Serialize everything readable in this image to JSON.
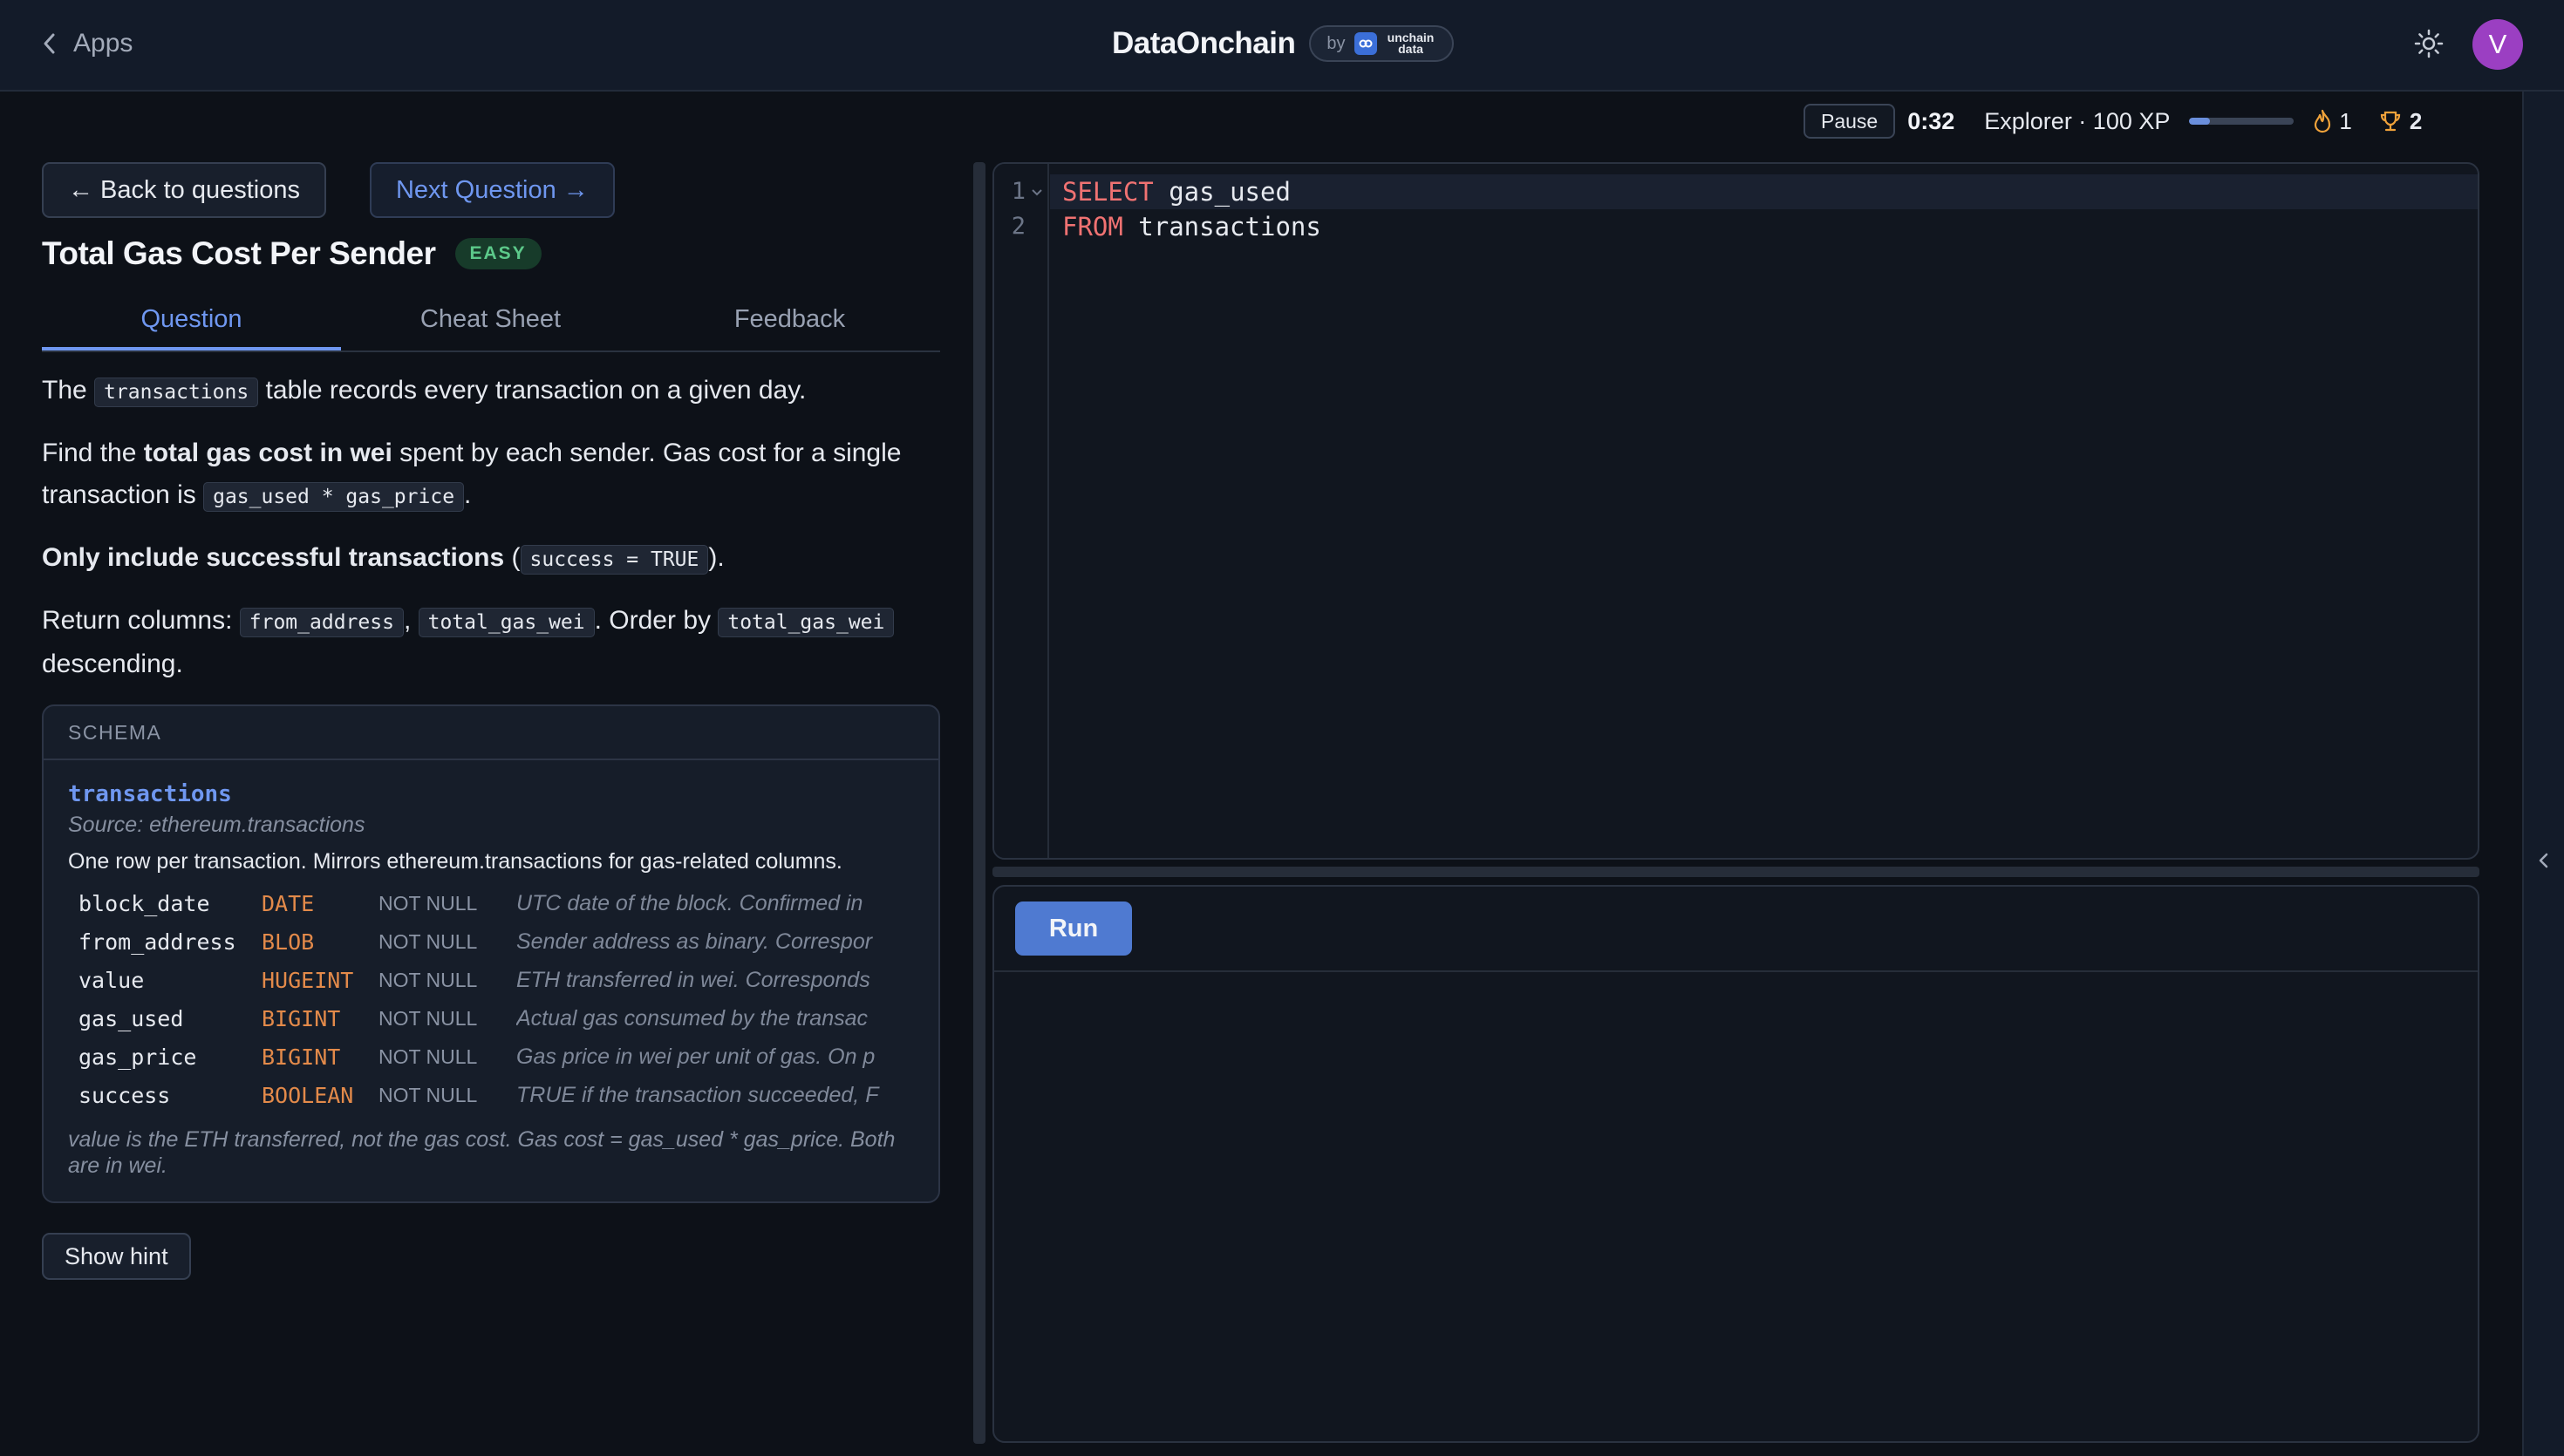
{
  "topbar": {
    "back_label": "Apps",
    "brand": "DataOnchain",
    "brand_by": "by",
    "brand_partner": "unchain data",
    "avatar_initial": "V"
  },
  "status": {
    "pause_label": "Pause",
    "timer": "0:32",
    "level_label": "Explorer · 100 XP",
    "xp_progress": 0.2,
    "streak": "1",
    "trophies": "2"
  },
  "nav": {
    "back_label": "← Back to questions",
    "next_label": "Next Question →"
  },
  "question": {
    "title": "Total Gas Cost Per Sender",
    "difficulty": "EASY",
    "tabs": [
      "Question",
      "Cheat Sheet",
      "Feedback"
    ],
    "active_tab": 0,
    "p1_pre": "The ",
    "p1_code": "transactions",
    "p1_post": " table records every transaction on a given day.",
    "p2_pre": "Find the ",
    "p2_bold": "total gas cost in wei",
    "p2_mid": " spent by each sender. Gas cost for a single transaction is ",
    "p2_code": "gas_used * gas_price",
    "p2_post": ".",
    "p3_bold": "Only include successful transactions",
    "p3_mid": " (",
    "p3_code": "success = TRUE",
    "p3_post": ").",
    "p4_pre": "Return columns: ",
    "p4_code1": "from_address",
    "p4_sep": ", ",
    "p4_code2": "total_gas_wei",
    "p4_mid": ". Order by ",
    "p4_code3": "total_gas_wei",
    "p4_post": " descending."
  },
  "schema": {
    "header": "SCHEMA",
    "table_name": "transactions",
    "source": "Source: ethereum.transactions",
    "description": "One row per transaction. Mirrors ethereum.transactions for gas-related columns.",
    "columns": [
      {
        "name": "block_date",
        "type": "DATE",
        "nullability": "NOT NULL",
        "desc": "UTC date of the block. Confirmed in"
      },
      {
        "name": "from_address",
        "type": "BLOB",
        "nullability": "NOT NULL",
        "desc": "Sender address as binary. Correspor"
      },
      {
        "name": "value",
        "type": "HUGEINT",
        "nullability": "NOT NULL",
        "desc": "ETH transferred in wei. Corresponds"
      },
      {
        "name": "gas_used",
        "type": "BIGINT",
        "nullability": "NOT NULL",
        "desc": "Actual gas consumed by the transac"
      },
      {
        "name": "gas_price",
        "type": "BIGINT",
        "nullability": "NOT NULL",
        "desc": "Gas price in wei per unit of gas. On p"
      },
      {
        "name": "success",
        "type": "BOOLEAN",
        "nullability": "NOT NULL",
        "desc": "TRUE if the transaction succeeded, F"
      }
    ],
    "note": "value is the ETH transferred, not the gas cost. Gas cost = gas_used * gas_price. Both are in wei."
  },
  "hint_label": "Show hint",
  "editor": {
    "lines": [
      {
        "num": "1",
        "keyword": "SELECT",
        "rest": " gas_used"
      },
      {
        "num": "2",
        "keyword": "FROM",
        "rest": " transactions"
      }
    ]
  },
  "results": {
    "run_label": "Run"
  },
  "colors": {
    "accent": "#6f97f0",
    "run": "#4f7ad1",
    "easy": "#5cc98a",
    "type": "#e38a4a",
    "keyword": "#f07272",
    "avatar": "#9b3fc2"
  },
  "icons": {
    "back": "chevron-left-icon",
    "theme": "sun-icon",
    "streak": "flame-icon",
    "trophy": "trophy-icon",
    "fold": "chevron-down-icon",
    "rail": "chevron-left-icon"
  }
}
